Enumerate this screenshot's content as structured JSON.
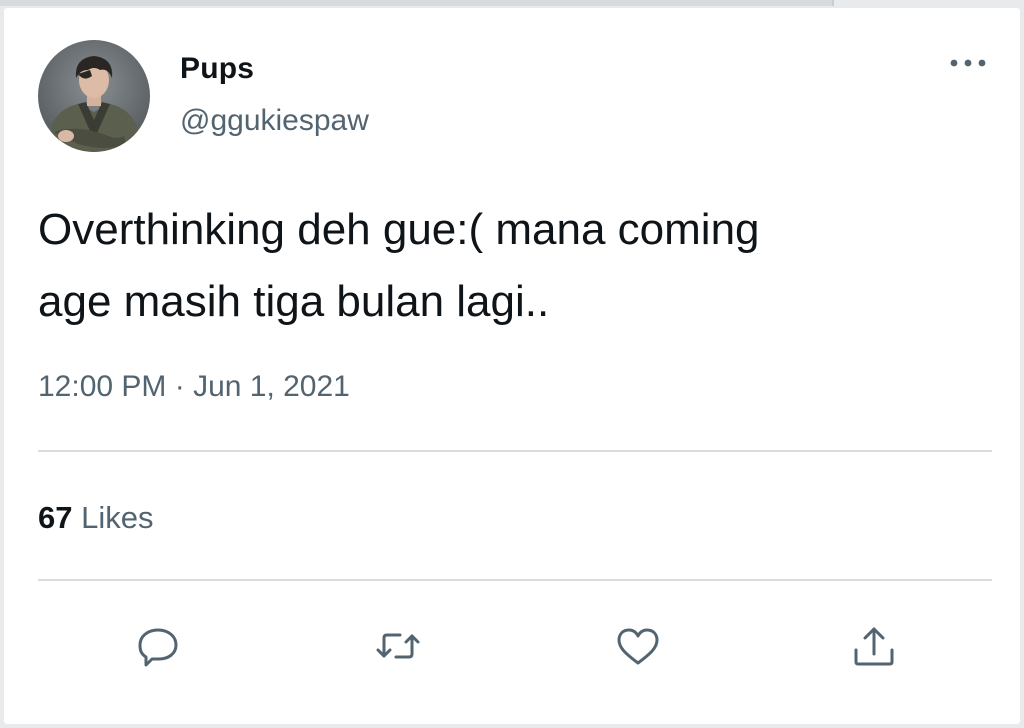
{
  "tweet": {
    "display_name": "Pups",
    "handle": "@ggukiespaw",
    "text_line1": "Overthinking deh gue:( mana coming",
    "text_line2": "age masih tiga bulan lagi..",
    "timestamp": "12:00 PM · Jun 1, 2021",
    "likes_count": "67",
    "likes_label": "Likes"
  },
  "icons": {
    "more": "more-horizontal-icon",
    "reply": "reply-bubble-icon",
    "retweet": "retweet-icon",
    "like": "heart-icon",
    "share": "share-upload-icon"
  },
  "colors": {
    "text_primary": "#0f1419",
    "text_secondary": "#536471",
    "divider": "#d8dde1"
  }
}
